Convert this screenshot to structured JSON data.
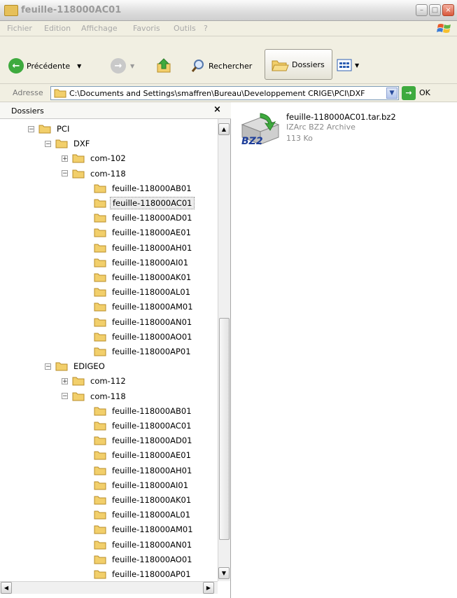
{
  "window": {
    "title": "feuille-118000AC01"
  },
  "menu": [
    "Fichier",
    "Edition",
    "Affichage",
    "Favoris",
    "Outils",
    "?"
  ],
  "toolbar": {
    "back_label": "Précédente",
    "search_label": "Rechercher",
    "folders_label": "Dossiers"
  },
  "address": {
    "label": "Adresse",
    "value": "C:\\Documents and Settings\\smaffren\\Bureau\\Developpement CRIGE\\PCI\\DXF",
    "go_label": "OK"
  },
  "pane": {
    "title": "Dossiers"
  },
  "tree": [
    {
      "label": "PCI",
      "exp": "−",
      "depth": 0
    },
    {
      "label": "DXF",
      "exp": "−",
      "depth": 1
    },
    {
      "label": "com-102",
      "exp": "+",
      "depth": 2
    },
    {
      "label": "com-118",
      "exp": "−",
      "depth": 2
    },
    {
      "label": "feuille-118000AB01",
      "exp": "",
      "depth": 3
    },
    {
      "label": "feuille-118000AC01",
      "exp": "",
      "depth": 3,
      "selected": true
    },
    {
      "label": "feuille-118000AD01",
      "exp": "",
      "depth": 3
    },
    {
      "label": "feuille-118000AE01",
      "exp": "",
      "depth": 3
    },
    {
      "label": "feuille-118000AH01",
      "exp": "",
      "depth": 3
    },
    {
      "label": "feuille-118000AI01",
      "exp": "",
      "depth": 3
    },
    {
      "label": "feuille-118000AK01",
      "exp": "",
      "depth": 3
    },
    {
      "label": "feuille-118000AL01",
      "exp": "",
      "depth": 3
    },
    {
      "label": "feuille-118000AM01",
      "exp": "",
      "depth": 3
    },
    {
      "label": "feuille-118000AN01",
      "exp": "",
      "depth": 3
    },
    {
      "label": "feuille-118000AO01",
      "exp": "",
      "depth": 3
    },
    {
      "label": "feuille-118000AP01",
      "exp": "",
      "depth": 3
    },
    {
      "label": "EDIGEO",
      "exp": "−",
      "depth": 1
    },
    {
      "label": "com-112",
      "exp": "+",
      "depth": 2
    },
    {
      "label": "com-118",
      "exp": "−",
      "depth": 2
    },
    {
      "label": "feuille-118000AB01",
      "exp": "",
      "depth": 3
    },
    {
      "label": "feuille-118000AC01",
      "exp": "",
      "depth": 3
    },
    {
      "label": "feuille-118000AD01",
      "exp": "",
      "depth": 3
    },
    {
      "label": "feuille-118000AE01",
      "exp": "",
      "depth": 3
    },
    {
      "label": "feuille-118000AH01",
      "exp": "",
      "depth": 3
    },
    {
      "label": "feuille-118000AI01",
      "exp": "",
      "depth": 3
    },
    {
      "label": "feuille-118000AK01",
      "exp": "",
      "depth": 3
    },
    {
      "label": "feuille-118000AL01",
      "exp": "",
      "depth": 3
    },
    {
      "label": "feuille-118000AM01",
      "exp": "",
      "depth": 3
    },
    {
      "label": "feuille-118000AN01",
      "exp": "",
      "depth": 3
    },
    {
      "label": "feuille-118000AO01",
      "exp": "",
      "depth": 3
    },
    {
      "label": "feuille-118000AP01",
      "exp": "",
      "depth": 3
    }
  ],
  "file": {
    "name": "feuille-118000AC01.tar.bz2",
    "type": "IZArc BZ2 Archive",
    "size": "113 Ko",
    "icon_text": "BZ2"
  },
  "colors": {
    "folder": "#f2cf6b",
    "accent": "#3eaa3e",
    "selection": "#ececec"
  }
}
